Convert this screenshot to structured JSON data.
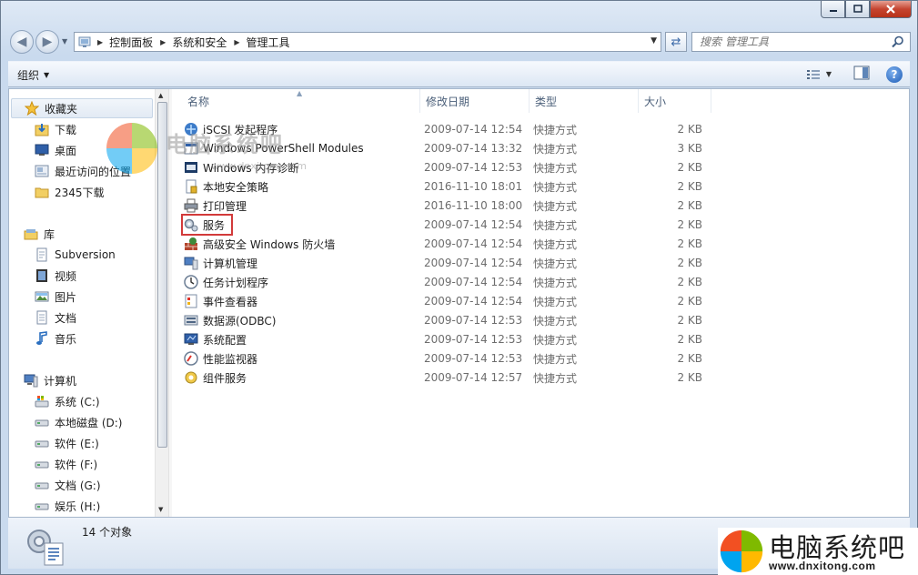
{
  "window": {
    "caption": {
      "minimize": "–",
      "maximize": "□",
      "close": "✕"
    }
  },
  "address": {
    "crumbs": [
      "控制面板",
      "系统和安全",
      "管理工具"
    ],
    "search_placeholder": "搜索 管理工具"
  },
  "toolbar": {
    "organize_label": "组织"
  },
  "nav": {
    "favorites_label": "收藏夹",
    "favorites": [
      "下载",
      "桌面",
      "最近访问的位置",
      "2345下载"
    ],
    "libraries_label": "库",
    "libraries": [
      "Subversion",
      "视频",
      "图片",
      "文档",
      "音乐"
    ],
    "computer_label": "计算机",
    "drives": [
      "系统 (C:)",
      "本地磁盘 (D:)",
      "软件 (E:)",
      "软件 (F:)",
      "文档 (G:)",
      "娱乐 (H:)"
    ]
  },
  "columns": {
    "name": "名称",
    "date": "修改日期",
    "type": "类型",
    "size": "大小"
  },
  "files": [
    {
      "name": "iSCSI 发起程序",
      "date": "2009-07-14 12:54",
      "type": "快捷方式",
      "size": "2 KB",
      "icon": "iscsi-icon"
    },
    {
      "name": "Windows PowerShell Modules",
      "date": "2009-07-14 13:32",
      "type": "快捷方式",
      "size": "3 KB",
      "icon": "powershell-icon"
    },
    {
      "name": "Windows 内存诊断",
      "date": "2009-07-14 12:53",
      "type": "快捷方式",
      "size": "2 KB",
      "icon": "memory-diagnostic-icon"
    },
    {
      "name": "本地安全策略",
      "date": "2016-11-10 18:01",
      "type": "快捷方式",
      "size": "2 KB",
      "icon": "security-policy-icon"
    },
    {
      "name": "打印管理",
      "date": "2016-11-10 18:00",
      "type": "快捷方式",
      "size": "2 KB",
      "icon": "printer-icon"
    },
    {
      "name": "服务",
      "date": "2009-07-14 12:54",
      "type": "快捷方式",
      "size": "2 KB",
      "icon": "gears-icon"
    },
    {
      "name": "高级安全 Windows 防火墙",
      "date": "2009-07-14 12:54",
      "type": "快捷方式",
      "size": "2 KB",
      "icon": "firewall-icon"
    },
    {
      "name": "计算机管理",
      "date": "2009-07-14 12:54",
      "type": "快捷方式",
      "size": "2 KB",
      "icon": "computer-management-icon"
    },
    {
      "name": "任务计划程序",
      "date": "2009-07-14 12:54",
      "type": "快捷方式",
      "size": "2 KB",
      "icon": "clock-icon"
    },
    {
      "name": "事件查看器",
      "date": "2009-07-14 12:54",
      "type": "快捷方式",
      "size": "2 KB",
      "icon": "event-viewer-icon"
    },
    {
      "name": "数据源(ODBC)",
      "date": "2009-07-14 12:53",
      "type": "快捷方式",
      "size": "2 KB",
      "icon": "odbc-icon"
    },
    {
      "name": "系统配置",
      "date": "2009-07-14 12:53",
      "type": "快捷方式",
      "size": "2 KB",
      "icon": "system-config-icon"
    },
    {
      "name": "性能监视器",
      "date": "2009-07-14 12:53",
      "type": "快捷方式",
      "size": "2 KB",
      "icon": "performance-monitor-icon"
    },
    {
      "name": "组件服务",
      "date": "2009-07-14 12:57",
      "type": "快捷方式",
      "size": "2 KB",
      "icon": "component-services-icon"
    }
  ],
  "status": {
    "count": "14 个对象"
  },
  "watermark": {
    "text": "电脑系统吧",
    "url": "www.dnxitong.com"
  },
  "brand": {
    "title": "电脑系统吧",
    "url": "www.dnxitong.com"
  },
  "colors": {
    "highlight": "#d23a3a",
    "accent": "#3b6aa8"
  }
}
